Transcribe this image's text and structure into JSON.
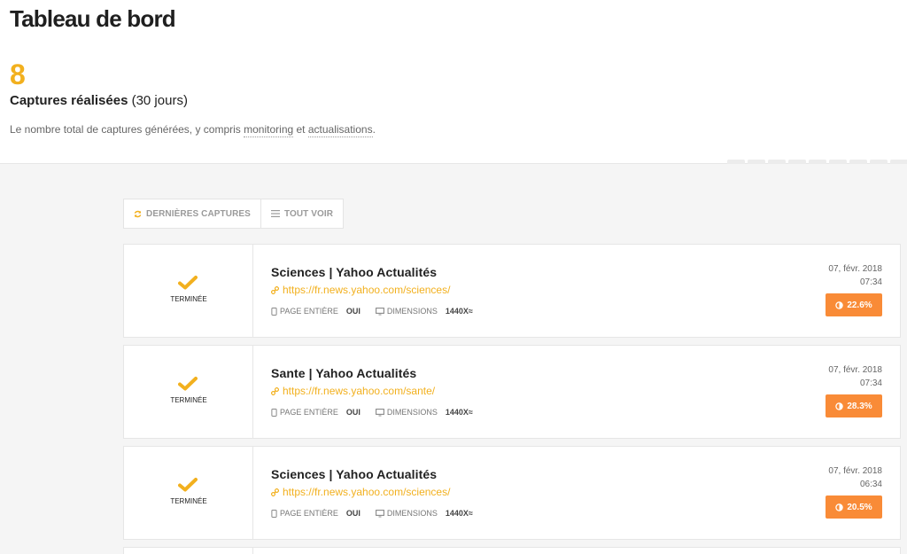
{
  "header": {
    "title": "Tableau de bord",
    "stat_number": "8",
    "stat_label_bold": "Captures réalisées",
    "stat_label_suffix": " (30 jours)",
    "desc_prefix": "Le nombre total de captures générées, y compris ",
    "desc_link1": "monitoring",
    "desc_middle": " et ",
    "desc_link2": "actualisations",
    "desc_suffix": "."
  },
  "tabs": [
    {
      "label": "DERNIÈRES CAPTURES",
      "icon": "refresh-icon"
    },
    {
      "label": "TOUT VOIR",
      "icon": "list-icon"
    }
  ],
  "captures": [
    {
      "status": "TERMINÉE",
      "title": "Sciences | Yahoo Actualités",
      "url": "https://fr.news.yahoo.com/sciences/",
      "page_label": "PAGE ENTIÈRE",
      "page_value": "OUI",
      "dim_label": "DIMENSIONS",
      "dim_value": "1440X≈",
      "date": "07, févr. 2018",
      "time": "07:34",
      "score": "22.6%"
    },
    {
      "status": "TERMINÉE",
      "title": "Sante | Yahoo Actualités",
      "url": "https://fr.news.yahoo.com/sante/",
      "page_label": "PAGE ENTIÈRE",
      "page_value": "OUI",
      "dim_label": "DIMENSIONS",
      "dim_value": "1440X≈",
      "date": "07, févr. 2018",
      "time": "07:34",
      "score": "28.3%"
    },
    {
      "status": "TERMINÉE",
      "title": "Sciences | Yahoo Actualités",
      "url": "https://fr.news.yahoo.com/sciences/",
      "page_label": "PAGE ENTIÈRE",
      "page_value": "OUI",
      "dim_label": "DIMENSIONS",
      "dim_value": "1440X≈",
      "date": "07, févr. 2018",
      "time": "06:34",
      "score": "20.5%"
    }
  ],
  "colors": {
    "accent": "#f2b01e",
    "badge": "#f98b37"
  }
}
